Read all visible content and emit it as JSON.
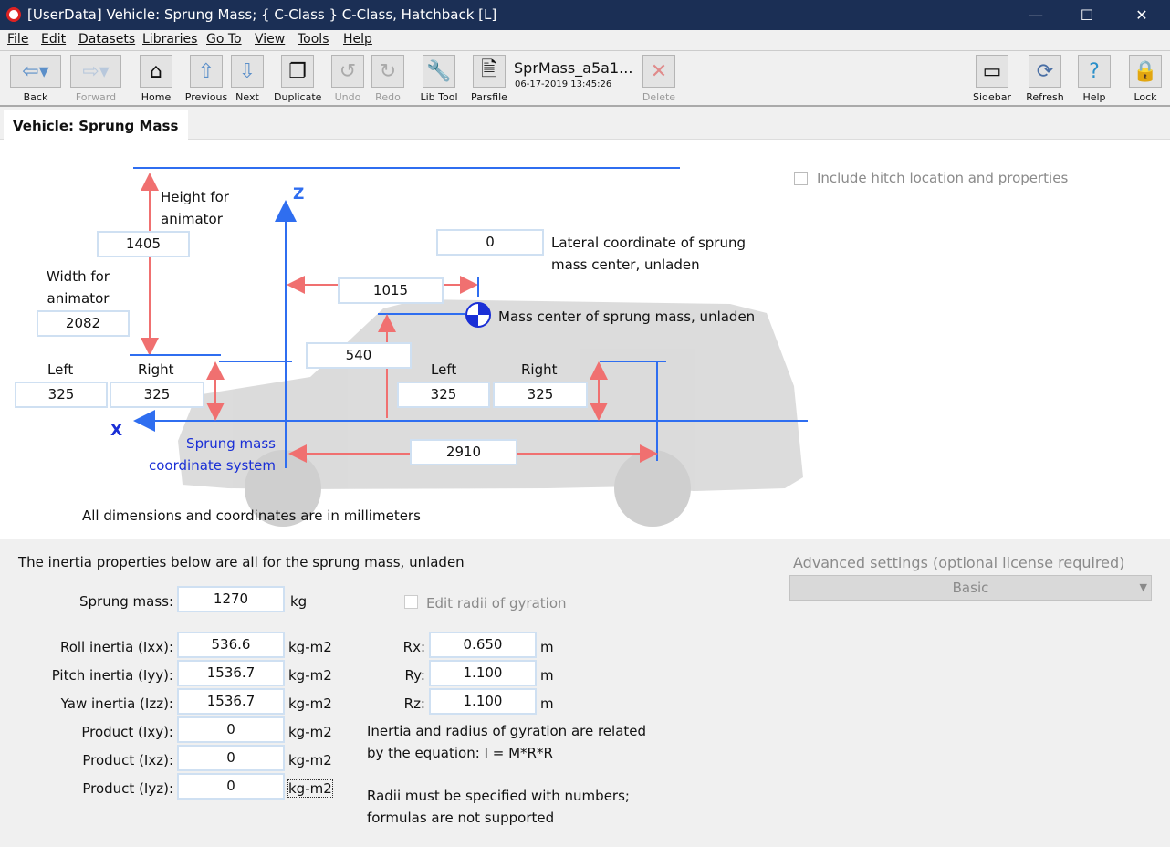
{
  "window": {
    "title": "[UserData] Vehicle: Sprung Mass; { C-Class } C-Class, Hatchback [L]"
  },
  "menu": [
    "File",
    "Edit",
    "Datasets",
    "Libraries",
    "Go To",
    "View",
    "Tools",
    "Help"
  ],
  "toolbar": {
    "back": "Back",
    "forward": "Forward",
    "home": "Home",
    "previous": "Previous",
    "next": "Next",
    "duplicate": "Duplicate",
    "undo": "Undo",
    "redo": "Redo",
    "libtool": "Lib Tool",
    "parsfile": "Parsfile",
    "dataset_name": "SprMass_a5a1...",
    "dataset_date": "06-17-2019 13:45:26",
    "delete": "Delete",
    "sidebar": "Sidebar",
    "refresh": "Refresh",
    "help": "Help",
    "lock": "Lock"
  },
  "tab": "Vehicle: Sprung Mass",
  "diagram": {
    "height_label": "Height for\nanimator",
    "height": "1405",
    "width_label": "Width for\nanimator",
    "width": "2082",
    "lateral": "0",
    "lateral_label": "Lateral coordinate of sprung\nmass center, unladen",
    "x_cg": "1015",
    "cg_label": "Mass center of sprung mass, unladen",
    "z_cg": "540",
    "left": "Left",
    "right": "Right",
    "front_left": "325",
    "front_right": "325",
    "rear_left": "325",
    "rear_right": "325",
    "wheelbase": "2910",
    "z_axis": "Z",
    "x_axis": "X",
    "coord_label": "Sprung mass\ncoordinate system",
    "units_note": "All dimensions and coordinates are in millimeters",
    "hitch_label": "Include hitch location and properties",
    "hitch_checked": false
  },
  "inertia": {
    "heading": "The inertia properties below are all for the sprung mass, unladen",
    "mass_label": "Sprung mass:",
    "mass": "1270",
    "mass_unit": "kg",
    "rows": [
      {
        "label": "Roll inertia (Ixx):",
        "value": "536.6",
        "unit": "kg-m2"
      },
      {
        "label": "Pitch inertia (Iyy):",
        "value": "1536.7",
        "unit": "kg-m2"
      },
      {
        "label": "Yaw inertia (Izz):",
        "value": "1536.7",
        "unit": "kg-m2"
      },
      {
        "label": "Product (Ixy):",
        "value": "0",
        "unit": "kg-m2"
      },
      {
        "label": "Product (Ixz):",
        "value": "0",
        "unit": "kg-m2"
      },
      {
        "label": "Product (Iyz):",
        "value": "0",
        "unit": "kg-m2"
      }
    ],
    "radii_check": "Edit radii of gyration",
    "radii_checked": false,
    "radii": [
      {
        "label": "Rx:",
        "value": "0.650",
        "unit": "m"
      },
      {
        "label": "Ry:",
        "value": "1.100",
        "unit": "m"
      },
      {
        "label": "Rz:",
        "value": "1.100",
        "unit": "m"
      }
    ],
    "note1": "Inertia and radius of gyration are related\nby the equation: I = M*R*R",
    "note2": "Radii must be specified with numbers;\nformulas are not supported"
  },
  "advanced": {
    "label": "Advanced settings (optional license required)",
    "value": "Basic"
  }
}
